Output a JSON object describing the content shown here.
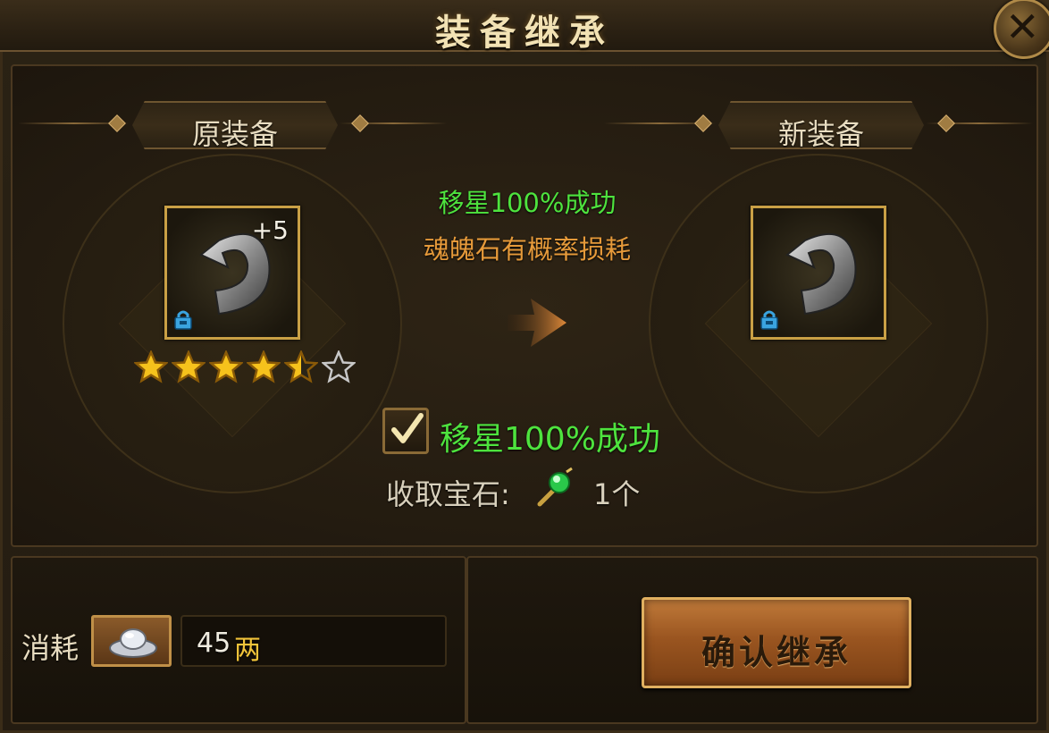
{
  "window": {
    "title": "装备继承"
  },
  "original": {
    "label": "原装备",
    "enhance": "+5",
    "stars_filled": 4.5,
    "stars_total": 6
  },
  "target": {
    "label": "新装备"
  },
  "info": {
    "success_text": "移星100%成功",
    "warning_text": "魂魄石有概率损耗"
  },
  "option": {
    "checked": true,
    "label": "移星100%成功"
  },
  "gem": {
    "label": "收取宝石:",
    "count": "1个"
  },
  "cost": {
    "label": "消耗",
    "amount": "45",
    "unit": "两"
  },
  "actions": {
    "confirm": "确认继承"
  },
  "colors": {
    "success": "#4ee33e",
    "warning": "#e69a3a",
    "gold": "#c9a045",
    "currency": "#f2c43a"
  },
  "icons": {
    "close": "close-icon",
    "lock": "lock-icon",
    "silver": "silver-ingot-icon",
    "gem": "green-gem-icon",
    "arrow": "arrow-right-icon",
    "check": "check-icon",
    "item": "hook-weapon-icon"
  }
}
